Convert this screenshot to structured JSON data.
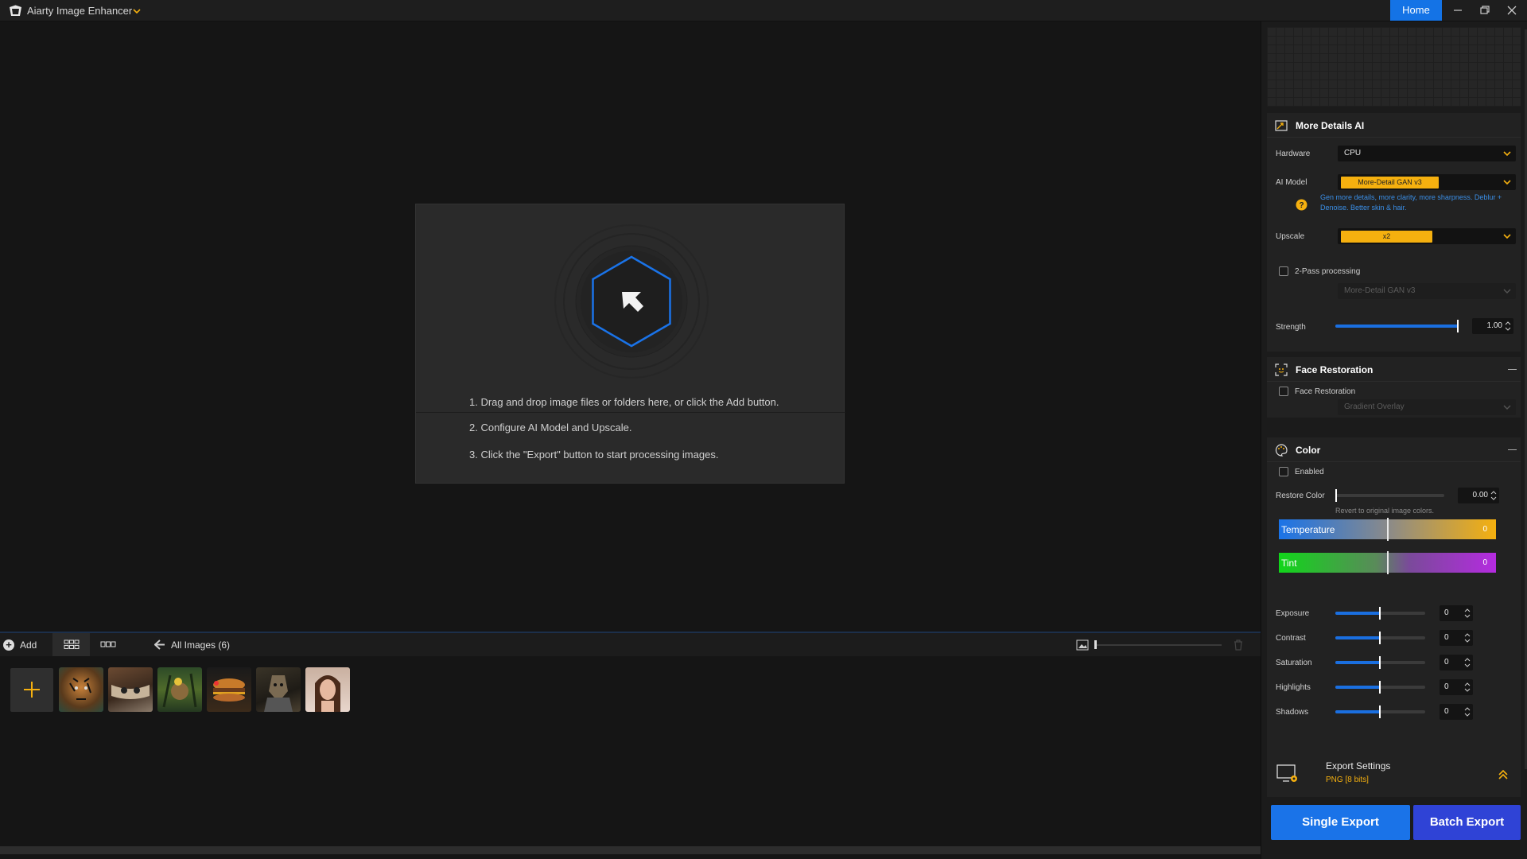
{
  "app": {
    "title": "Aiarty Image Enhancer",
    "home_label": "Home"
  },
  "welcome": {
    "steps": [
      "1. Drag and drop image files or folders here, or click the Add button.",
      "2. Configure AI Model and Upscale.",
      "3. Click the \"Export\" button to start processing images."
    ]
  },
  "gallery": {
    "add_label": "Add",
    "all_images_label": "All Images (6)",
    "thumbnails": [
      "tiger",
      "owl",
      "forest-cat",
      "burger",
      "armored-dog",
      "woman-portrait"
    ]
  },
  "panel": {
    "more_details": {
      "title": "More Details AI",
      "hardware_label": "Hardware",
      "hardware_value": "CPU",
      "ai_model_label": "AI Model",
      "ai_model_value": "More-Detail GAN  v3",
      "ai_model_hint": "Gen more details, more clarity, more sharpness. Deblur + Denoise. Better skin & hair.",
      "upscale_label": "Upscale",
      "upscale_value": "x2",
      "two_pass_label": "2-Pass processing",
      "two_pass_model": "More-Detail GAN  v3",
      "strength_label": "Strength",
      "strength_value": "1.00",
      "strength_fraction": 1.0
    },
    "face_restoration": {
      "title": "Face Restoration",
      "checkbox_label": "Face Restoration",
      "model": "Gradient Overlay"
    },
    "color": {
      "title": "Color",
      "enabled_label": "Enabled",
      "restore_label": "Restore Color",
      "restore_value": "0.00",
      "restore_hint": "Revert to original image colors.",
      "temperature_label": "Temperature",
      "temperature_value": "0",
      "tint_label": "Tint",
      "tint_value": "0",
      "adjustments": [
        {
          "label": "Exposure",
          "value": "0"
        },
        {
          "label": "Contrast",
          "value": "0"
        },
        {
          "label": "Saturation",
          "value": "0"
        },
        {
          "label": "Highlights",
          "value": "0"
        },
        {
          "label": "Shadows",
          "value": "0"
        }
      ]
    },
    "export": {
      "title": "Export Settings",
      "format": "PNG   [8 bits]",
      "single_label": "Single Export",
      "batch_label": "Batch Export"
    }
  },
  "colors": {
    "accent": "#1a73e8",
    "highlight": "#f5b00f",
    "batch": "#2f43d6",
    "info": "#3a8ee6"
  }
}
